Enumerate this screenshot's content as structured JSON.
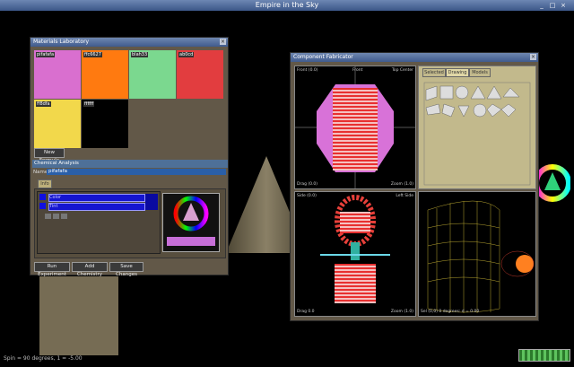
{
  "window_title": "Empire in the Sky",
  "materials_lab": {
    "title": "Materials Laboratory",
    "swatches": [
      {
        "label": "pifafafa",
        "color": "#d96fcf"
      },
      {
        "label": "ffc6627",
        "color": "#ff7a10"
      },
      {
        "label": "blah33",
        "color": "#7bd88f"
      },
      {
        "label": "ab0cd",
        "color": "#e23d3f"
      },
      {
        "label": "ff8dfa",
        "color": "#f2d84b"
      },
      {
        "label": "ffffff",
        "color": "#000000"
      }
    ],
    "new_formula": "New Formula",
    "chem_header": "Chemical Analysis",
    "name_label": "Name",
    "name_value": "pifafafa",
    "tab": "Info",
    "list_items": [
      "Color",
      "Tint"
    ],
    "run_button": "Run Experiment",
    "add_button": "Add Chemistry",
    "save_button": "Save Changes"
  },
  "fabricator": {
    "title": "Component Fabricator",
    "tabs": [
      "Selected",
      "Drawing",
      "Models"
    ],
    "views": [
      {
        "tl": "Front (0.0)",
        "tc": "Front",
        "tr": "Top Center",
        "bl": "Drag (0.0)",
        "br": "Zoom (1.0)"
      },
      {
        "tl": "Side (0.0)",
        "tr": "Left Side",
        "bl": "Drag 0.0",
        "br": "Zoom (1.0)"
      },
      {
        "bl": "Sel (0,0) 0 degrees: d = 0.00"
      }
    ]
  },
  "status": "Spin = 90 degrees, 1 = -5.00",
  "colors": {
    "title": "#405b8d",
    "panel": "#625848",
    "accent": "#2222ff"
  }
}
